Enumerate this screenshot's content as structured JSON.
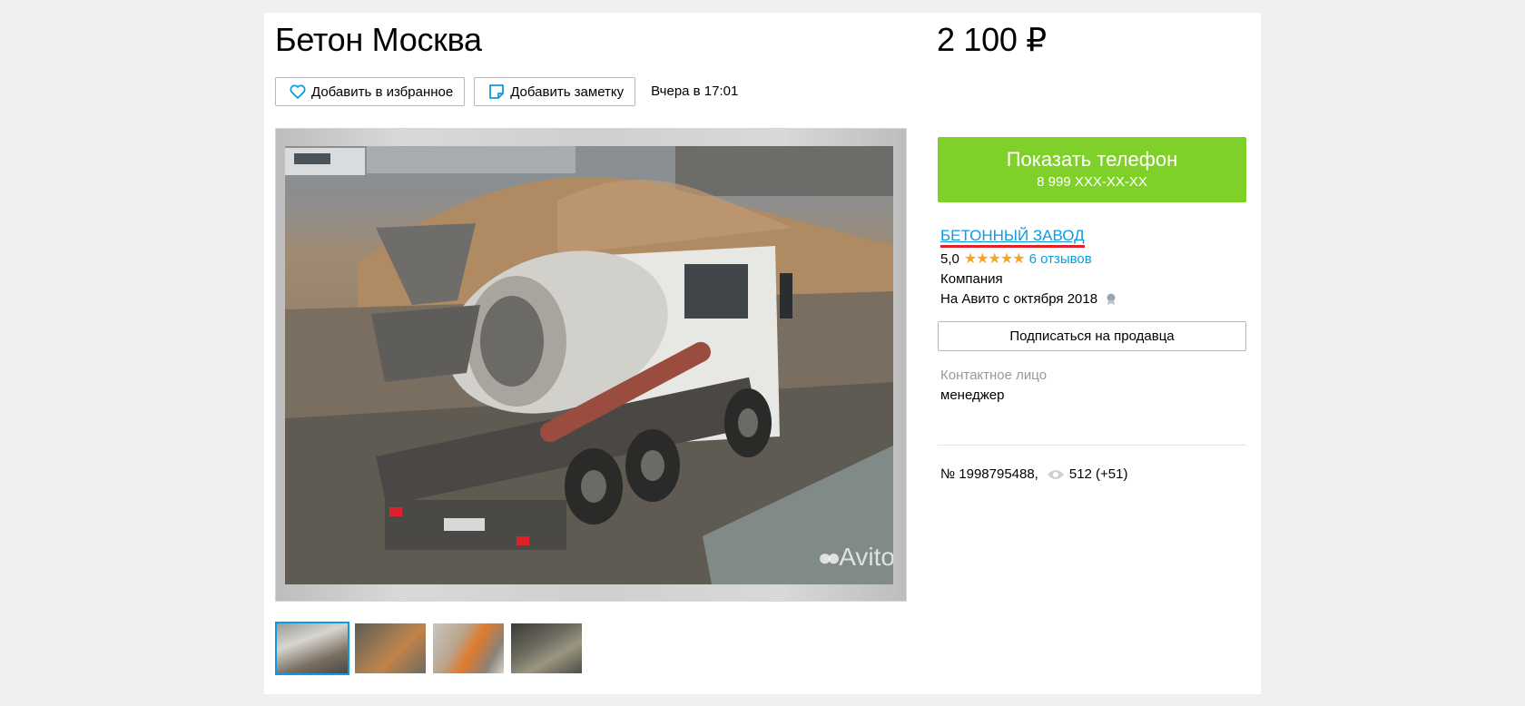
{
  "listing": {
    "title": "Бетон Москва",
    "price": "2 100 ₽",
    "posted": "Вчера в 17:01"
  },
  "actions": {
    "favorite_label": "Добавить в избранное",
    "favorite_icon": "heart-icon",
    "note_label": "Добавить заметку",
    "note_icon": "note-icon"
  },
  "gallery": {
    "watermark": "Avito",
    "thumbnails": [
      {
        "label": "thumbnail-1",
        "active": true
      },
      {
        "label": "thumbnail-2",
        "active": false
      },
      {
        "label": "thumbnail-3",
        "active": false
      },
      {
        "label": "thumbnail-4",
        "active": false
      }
    ]
  },
  "phone": {
    "label": "Показать телефон",
    "number": "8 999 XXX-XX-XX",
    "color": "#7fd12a"
  },
  "seller": {
    "name": "БЕТОННЫЙ ЗАВОД",
    "rating": "5,0",
    "stars": 5,
    "reviews": "6 отзывов",
    "type": "Компания",
    "since": "На Авито с октября 2018",
    "subscribe_label": "Подписаться на продавца"
  },
  "contact": {
    "label": "Контактное лицо",
    "value": "менеджер"
  },
  "meta": {
    "ad_number": "№ 1998795488,",
    "views": "512 (+51)"
  },
  "colors": {
    "link": "#0a9be0",
    "accent_underline": "#e2222a",
    "star": "#f5a623"
  }
}
